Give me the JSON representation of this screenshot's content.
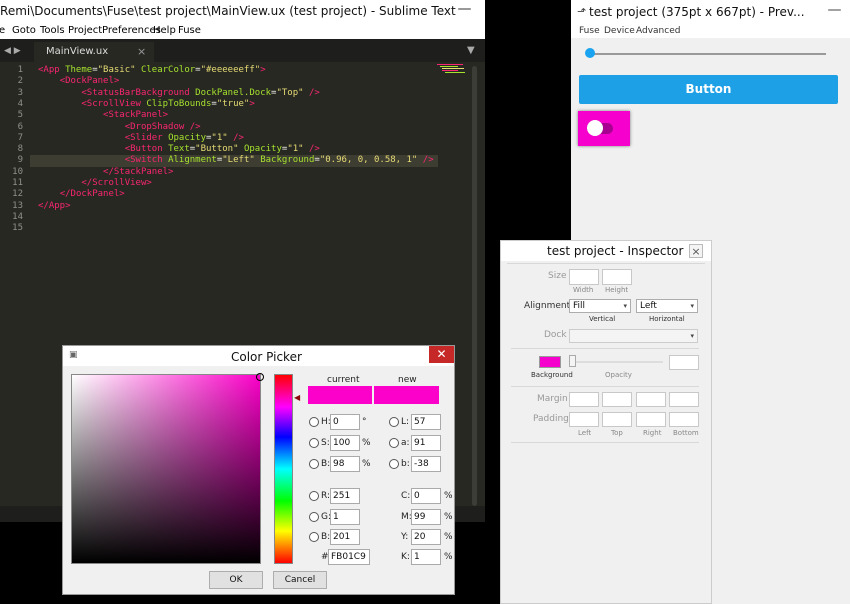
{
  "sublime": {
    "title": "\\Remi\\Documents\\Fuse\\test project\\MainView.ux (test project) - Sublime Text",
    "minimize": "—",
    "menu": [
      "e",
      "Goto",
      "Tools",
      "Project",
      "Preferences",
      "Help",
      "Fuse"
    ],
    "tab": "MainView.ux",
    "tab_close": "×",
    "nav": "◀ ▶",
    "tab_dropdown": "▼",
    "line_numbers": [
      "1",
      "2",
      "3",
      "4",
      "5",
      "6",
      "7",
      "8",
      "9",
      "10",
      "11",
      "12",
      "13",
      "14",
      "15"
    ],
    "code": [
      [
        [
          "tg",
          "<App "
        ],
        [
          "at",
          "Theme"
        ],
        [
          "pn",
          "="
        ],
        [
          "st",
          "\"Basic\""
        ],
        [
          "pn",
          " "
        ],
        [
          "at",
          "ClearColor"
        ],
        [
          "pn",
          "="
        ],
        [
          "st",
          "\"#eeeeeeff\""
        ],
        [
          "tg",
          ">"
        ]
      ],
      [
        [
          "pn",
          "    "
        ],
        [
          "tg",
          "<DockPanel>"
        ]
      ],
      [
        [
          "pn",
          "        "
        ],
        [
          "tg",
          "<StatusBarBackground "
        ],
        [
          "at",
          "DockPanel.Dock"
        ],
        [
          "pn",
          "="
        ],
        [
          "st",
          "\"Top\""
        ],
        [
          "tg",
          " />"
        ]
      ],
      [
        [
          "pn",
          "        "
        ],
        [
          "tg",
          "<ScrollView "
        ],
        [
          "at",
          "ClipToBounds"
        ],
        [
          "pn",
          "="
        ],
        [
          "st",
          "\"true\""
        ],
        [
          "tg",
          ">"
        ]
      ],
      [
        [
          "pn",
          "            "
        ],
        [
          "tg",
          "<StackPanel>"
        ]
      ],
      [
        [
          "pn",
          "                "
        ],
        [
          "tg",
          "<DropShadow />"
        ]
      ],
      [
        [
          "pn",
          "                "
        ],
        [
          "tg",
          "<Slider "
        ],
        [
          "at",
          "Opacity"
        ],
        [
          "pn",
          "="
        ],
        [
          "st",
          "\"1\""
        ],
        [
          "tg",
          " />"
        ]
      ],
      [
        [
          "pn",
          "                "
        ],
        [
          "tg",
          "<Button "
        ],
        [
          "at",
          "Text"
        ],
        [
          "pn",
          "="
        ],
        [
          "st",
          "\"Button\""
        ],
        [
          "pn",
          " "
        ],
        [
          "at",
          "Opacity"
        ],
        [
          "pn",
          "="
        ],
        [
          "st",
          "\"1\""
        ],
        [
          "tg",
          " />"
        ]
      ],
      [
        [
          "pn",
          "                "
        ],
        [
          "tg",
          "<Switch "
        ],
        [
          "at",
          "Alignment"
        ],
        [
          "pn",
          "="
        ],
        [
          "st",
          "\"Left\""
        ],
        [
          "pn",
          " "
        ],
        [
          "at",
          "Background"
        ],
        [
          "pn",
          "="
        ],
        [
          "st",
          "\"0.96, 0, 0.58, 1\""
        ],
        [
          "tg",
          " />"
        ]
      ],
      [
        [
          "pn",
          "            "
        ],
        [
          "tg",
          "</StackPanel>"
        ]
      ],
      [
        [
          "pn",
          "        "
        ],
        [
          "tg",
          "</ScrollView>"
        ]
      ],
      [
        [
          "pn",
          "    "
        ],
        [
          "tg",
          "</DockPanel>"
        ]
      ],
      [
        [
          "tg",
          "</App>"
        ]
      ],
      [],
      []
    ],
    "highlight_line": 8
  },
  "preview": {
    "title": "test project (375pt x 667pt) - Prev...",
    "icon": "fuse-icon",
    "minimize": "—",
    "menu": [
      "Fuse",
      "Device",
      "Advanced"
    ],
    "slider_value": 0,
    "button_label": "Button",
    "switch_on": false,
    "switch_color": "#f500cc",
    "button_color": "#1ea0e6"
  },
  "inspector": {
    "title": "test project - Inspector",
    "close": "×",
    "size_label": "Size",
    "width_label": "Width",
    "height_label": "Height",
    "alignment_label": "Alignment",
    "vertical_value": "Fill",
    "horizontal_value": "Left",
    "vertical_label": "Vertical",
    "horizontal_label": "Horizontal",
    "dock_label": "Dock",
    "background_label": "Background",
    "opacity_label": "Opacity",
    "margin_label": "Margin",
    "padding_label": "Padding",
    "left_label": "Left",
    "top_label": "Top",
    "right_label": "Right",
    "bottom_label": "Bottom",
    "background_color": "#f500cc"
  },
  "picker": {
    "title": "Color Picker",
    "close": "✕",
    "current_label": "current",
    "new_label": "new",
    "h_label": "H:",
    "h_value": "0",
    "h_unit": "°",
    "s_label": "S:",
    "s_value": "100",
    "s_unit": "%",
    "b_label": "B:",
    "b_value": "98",
    "b_unit": "%",
    "L_label": "L:",
    "L_value": "57",
    "a_label": "a:",
    "a_value": "91",
    "lab_b_label": "b:",
    "lab_b_value": "-38",
    "r_label": "R:",
    "r_value": "251",
    "g_label": "G:",
    "g_value": "1",
    "bb_label": "B:",
    "bb_value": "201",
    "hex_label": "#",
    "hex_value": "FB01C9",
    "c_label": "C:",
    "c_value": "0",
    "m_label": "M:",
    "m_value": "99",
    "y_label": "Y:",
    "y_value": "20",
    "k_label": "K:",
    "k_value": "1",
    "pct": "%",
    "ok": "OK",
    "cancel": "Cancel",
    "color": "#fb01c9"
  }
}
